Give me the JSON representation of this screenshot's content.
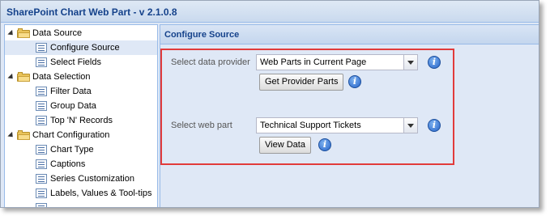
{
  "window": {
    "title": "SharePoint Chart Web Part - v 2.1.0.8"
  },
  "tree": {
    "items": [
      {
        "label": "Data Source",
        "type": "folder",
        "level": 0
      },
      {
        "label": "Configure Source",
        "type": "leaf",
        "level": 1,
        "selected": true
      },
      {
        "label": "Select Fields",
        "type": "leaf",
        "level": 1
      },
      {
        "label": "Data Selection",
        "type": "folder",
        "level": 0
      },
      {
        "label": "Filter Data",
        "type": "leaf",
        "level": 1
      },
      {
        "label": "Group Data",
        "type": "leaf",
        "level": 1
      },
      {
        "label": "Top 'N' Records",
        "type": "leaf",
        "level": 1
      },
      {
        "label": "Chart Configuration",
        "type": "folder",
        "level": 0
      },
      {
        "label": "Chart Type",
        "type": "leaf",
        "level": 1
      },
      {
        "label": "Captions",
        "type": "leaf",
        "level": 1
      },
      {
        "label": "Series Customization",
        "type": "leaf",
        "level": 1
      },
      {
        "label": "Labels, Values & Tool-tips",
        "type": "leaf",
        "level": 1
      }
    ]
  },
  "panel": {
    "title": "Configure Source",
    "provider_label": "Select data provider",
    "provider_value": "Web Parts in Current Page",
    "get_provider_button": "Get Provider Parts",
    "webpart_label": "Select web part",
    "webpart_value": "Technical Support Tickets",
    "view_data_button": "View Data",
    "info_glyph": "i"
  },
  "colors": {
    "highlight_border": "#e23b3b",
    "header_text": "#15428b",
    "panel_bg": "#dfe8f6"
  }
}
